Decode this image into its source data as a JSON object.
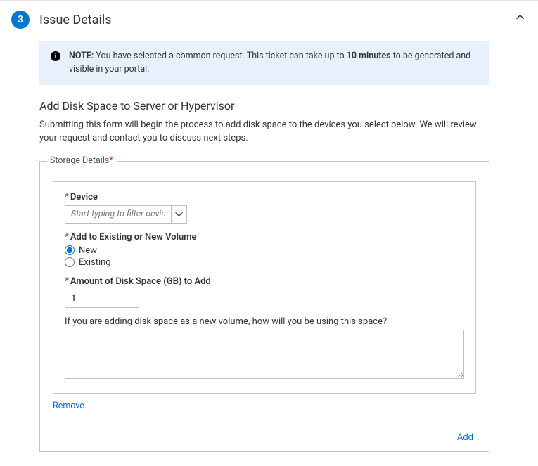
{
  "step": {
    "number": "3",
    "title": "Issue Details"
  },
  "note": {
    "prefix": "NOTE:",
    "text_before": " You have selected a common request. This ticket can take up to ",
    "emphasis": "10 minutes",
    "text_after": " to be generated and visible in your portal."
  },
  "section": {
    "title": "Add Disk Space to Server or Hypervisor",
    "description": "Submitting this form will begin the process to add disk space to the devices you select below. We will review your request and contact you to discuss next steps."
  },
  "storage": {
    "legend": "Storage Details",
    "device_label": "Device",
    "device_placeholder": "Start typing to filter devices",
    "volume_label": "Add to Existing or New Volume",
    "volume_new": "New",
    "volume_existing": "Existing",
    "volume_selected": "new",
    "amount_label": "Amount of Disk Space (GB) to Add",
    "amount_value": "1",
    "usage_label": "If you are adding disk space as a new volume, how will you be using this space?",
    "remove_label": "Remove",
    "add_label": "Add"
  }
}
